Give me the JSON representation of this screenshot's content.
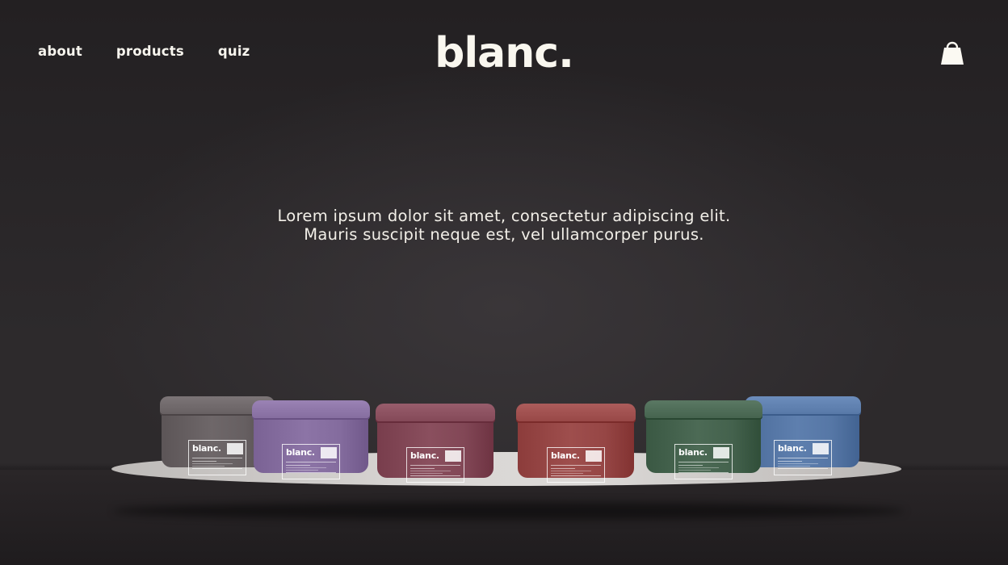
{
  "header": {
    "nav": [
      {
        "label": "about"
      },
      {
        "label": "products"
      },
      {
        "label": "quiz"
      }
    ],
    "logo": "blanc.",
    "cart_icon": "shopping-bag-icon"
  },
  "hero": {
    "line1": "Lorem ipsum dolor sit amet, consectetur adipiscing elit.",
    "line2": "Mauris suscipit neque est, vel ullamcorper purus."
  },
  "products": [
    {
      "brand": "blanc.",
      "color": "#6e6769"
    },
    {
      "brand": "blanc.",
      "color": "#8c74a6"
    },
    {
      "brand": "blanc.",
      "color": "#8a4f5e"
    },
    {
      "brand": "blanc.",
      "color": "#9e4e4d"
    },
    {
      "brand": "blanc.",
      "color": "#4c6a55"
    },
    {
      "brand": "blanc.",
      "color": "#5e7fae"
    }
  ],
  "colors": {
    "background": "#2b282a",
    "text": "#f4f1ea",
    "platform": "#d5d2d0"
  }
}
